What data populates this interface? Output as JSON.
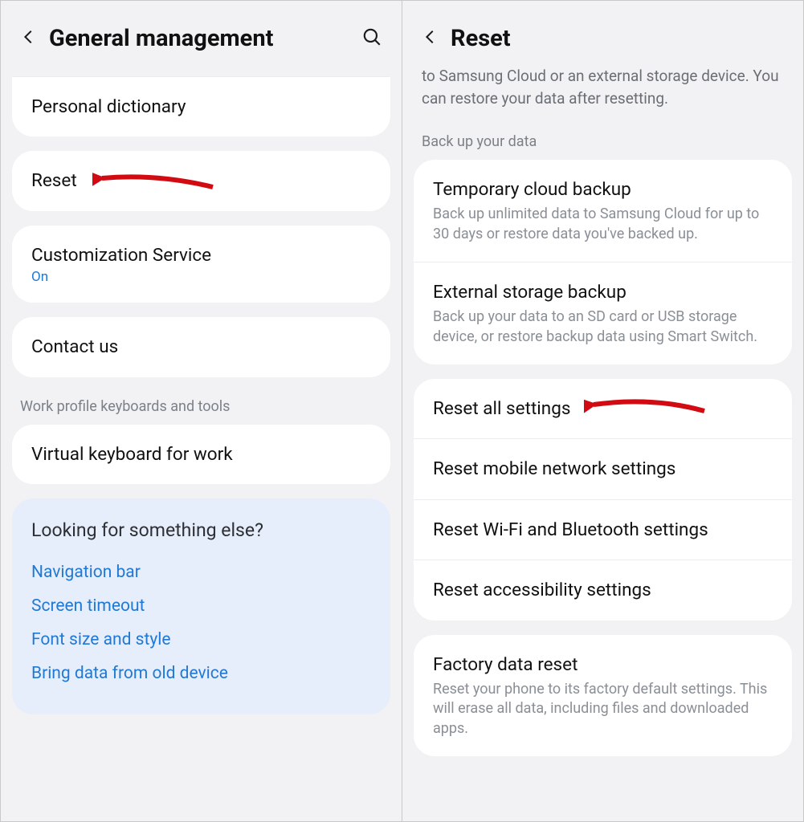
{
  "left": {
    "header": {
      "title": "General management"
    },
    "personal_dictionary": "Personal dictionary",
    "reset": "Reset",
    "customization": {
      "title": "Customization Service",
      "status": "On"
    },
    "contact_us": "Contact us",
    "section_work": "Work profile keyboards and tools",
    "virtual_keyboard_work": "Virtual keyboard for work",
    "suggest": {
      "title": "Looking for something else?",
      "links": [
        "Navigation bar",
        "Screen timeout",
        "Font size and style",
        "Bring data from old device"
      ]
    }
  },
  "right": {
    "header": {
      "title": "Reset"
    },
    "intro": "to Samsung Cloud or an external storage device. You can restore your data after resetting.",
    "section_backup": "Back up your data",
    "backup_items": [
      {
        "title": "Temporary cloud backup",
        "desc": "Back up unlimited data to Samsung Cloud for up to 30 days or restore data you've backed up."
      },
      {
        "title": "External storage backup",
        "desc": "Back up your data to an SD card or USB storage device, or restore backup data using Smart Switch."
      }
    ],
    "reset_items": [
      "Reset all settings",
      "Reset mobile network settings",
      "Reset Wi-Fi and Bluetooth settings",
      "Reset accessibility settings"
    ],
    "factory": {
      "title": "Factory data reset",
      "desc": "Reset your phone to its factory default settings. This will erase all data, including files and downloaded apps."
    }
  }
}
